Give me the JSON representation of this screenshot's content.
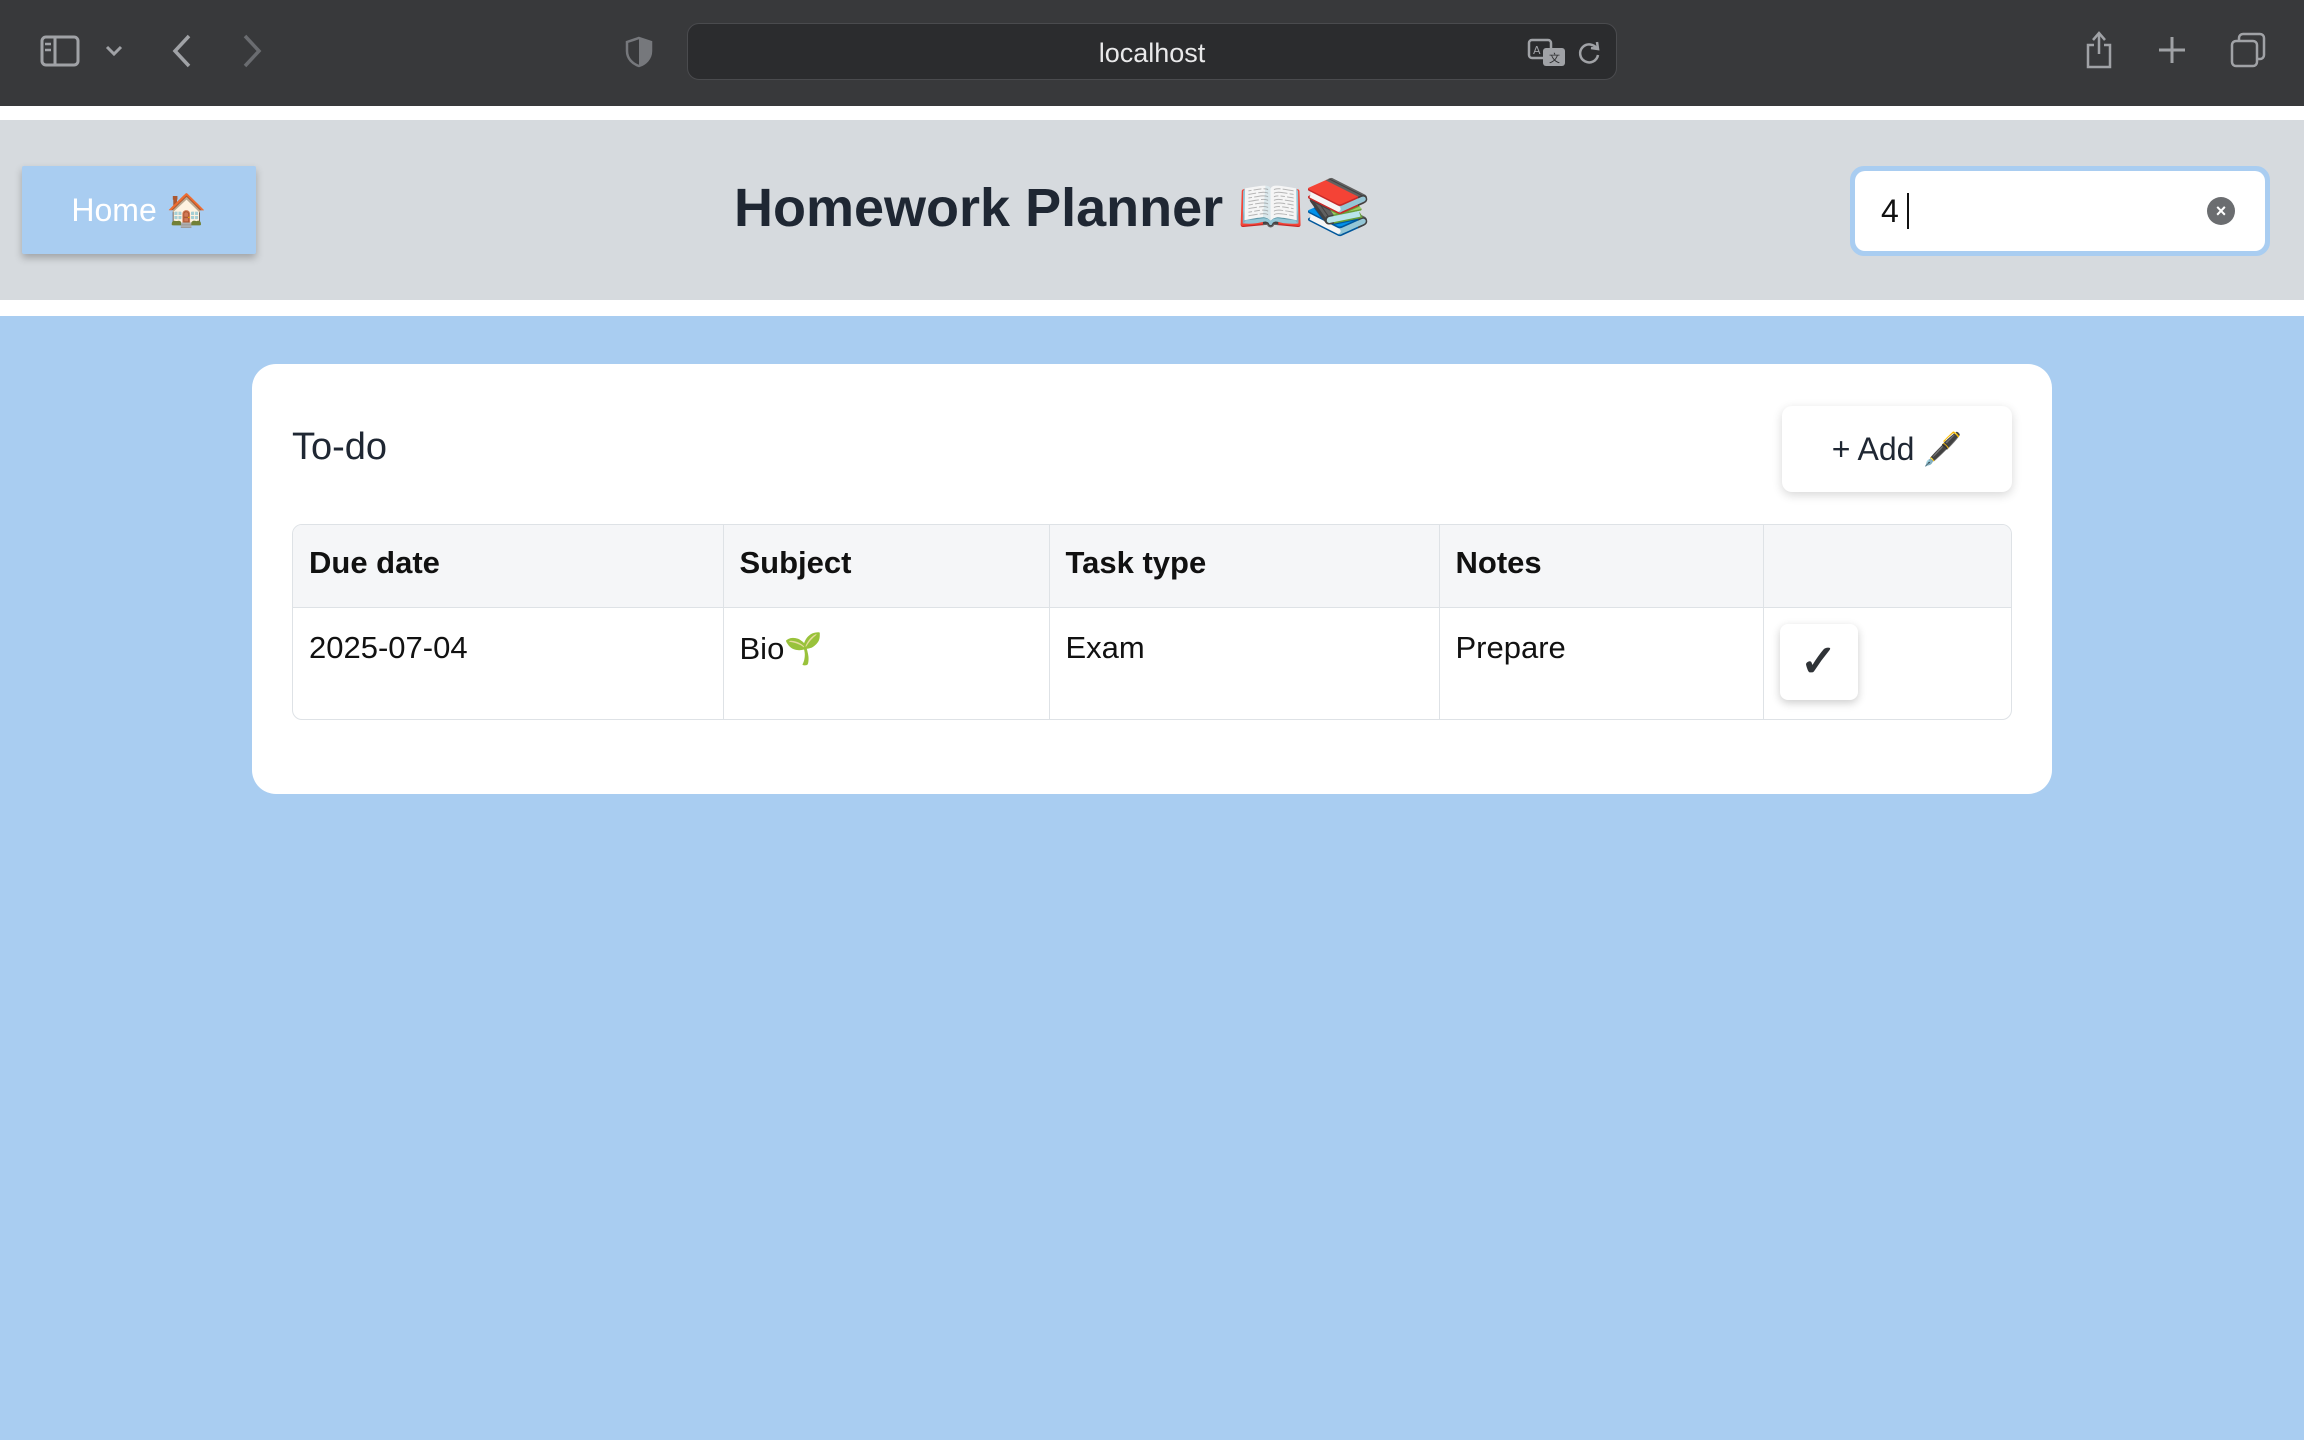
{
  "browser": {
    "url": "localhost"
  },
  "header": {
    "home_label": "Home",
    "home_emoji": "🏠",
    "title": "Homework Planner",
    "title_emoji": "📖📚",
    "search_value": "4"
  },
  "todo": {
    "title": "To-do",
    "add_label": "+ Add",
    "add_emoji": "🖋️",
    "columns": [
      "Due date",
      "Subject",
      "Task type",
      "Notes",
      ""
    ],
    "rows": [
      {
        "due_date": "2025-07-04",
        "subject": "Bio🌱",
        "task_type": "Exam",
        "notes": "Prepare",
        "action_glyph": "✓"
      }
    ]
  },
  "colors": {
    "accent": "#a9cdf1",
    "header_bg": "#d6dade",
    "text_dark": "#1f2733"
  }
}
